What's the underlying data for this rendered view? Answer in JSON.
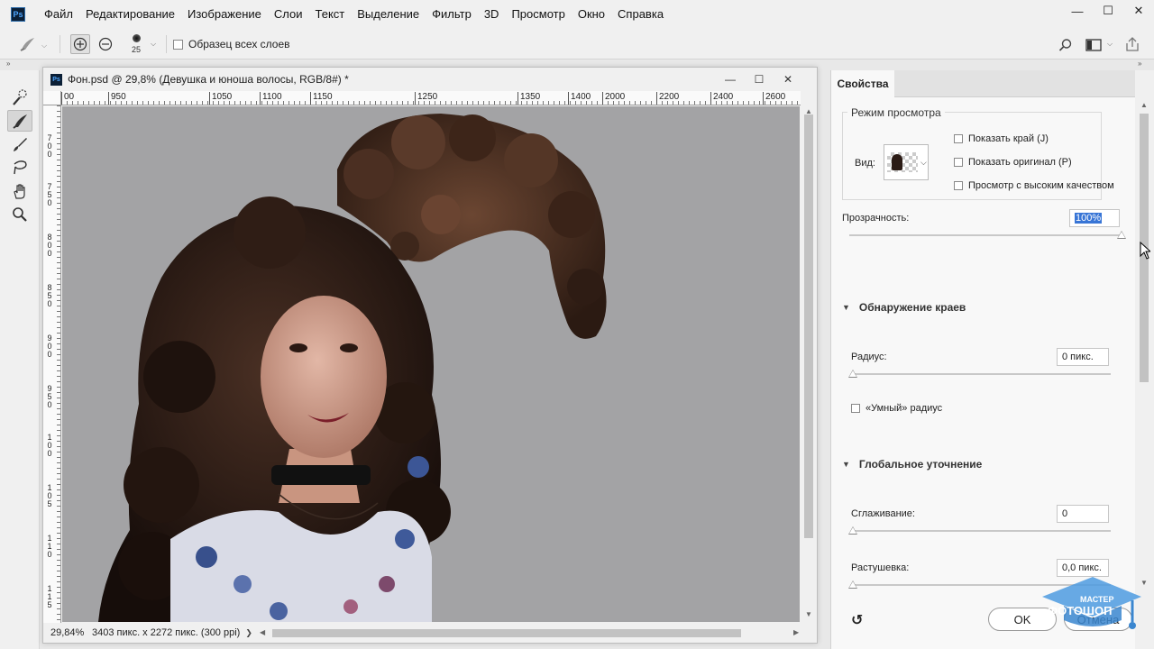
{
  "menu": {
    "logo": "Ps",
    "items": [
      "Файл",
      "Редактирование",
      "Изображение",
      "Слои",
      "Текст",
      "Выделение",
      "Фильтр",
      "3D",
      "Просмотр",
      "Окно",
      "Справка"
    ],
    "window_controls": [
      "—",
      "☐",
      "✕"
    ]
  },
  "options": {
    "brush_size": "25",
    "sample_all_layers_label": "Образец всех слоев",
    "sample_all_layers_checked": false
  },
  "toolbar": {
    "tools": [
      "quick-selection-icon",
      "refine-edge-brush-icon",
      "brush-icon",
      "lasso-icon",
      "hand-icon",
      "zoom-icon"
    ],
    "active_index": 1
  },
  "document": {
    "logo": "Ps",
    "title": "Фон.psd @ 29,8% (Девушка и юноша волосы, RGB/8#) *",
    "ruler_top": [
      "00",
      "950",
      "1050",
      "1100",
      "1150",
      "1250",
      "1350",
      "1400",
      "2000",
      "2200",
      "2400",
      "2600"
    ],
    "ruler_left": [
      "7",
      "0",
      "0",
      "7",
      "5",
      "0",
      "8",
      "0",
      "0",
      "8",
      "5",
      "0",
      "9",
      "0",
      "0",
      "9",
      "5",
      "0",
      "1",
      "0",
      "0",
      "1",
      "0",
      "5",
      "1",
      "1",
      "0",
      "1",
      "1",
      "5"
    ],
    "zoom": "29,84%",
    "info": "3403 пикс. x 2272 пикс. (300 ppi)",
    "info_arrow": "❯",
    "canvas_bg": "#a3a3a5"
  },
  "panel": {
    "tab": "Свойства",
    "view_mode": {
      "title": "Режим просмотра",
      "view_label": "Вид:",
      "show_edge": "Показать край (J)",
      "show_original": "Показать оригинал (P)",
      "high_quality": "Просмотр с высоким качеством"
    },
    "opacity_label": "Прозрачность:",
    "opacity_value": "100%",
    "opacity_fraction": 1.0,
    "edge_detection": {
      "title": "Обнаружение краев",
      "radius_label": "Радиус:",
      "radius_value": "0 пикс.",
      "smart_radius": "«Умный» радиус"
    },
    "global_refine": {
      "title": "Глобальное уточнение",
      "smooth_label": "Сглаживание:",
      "smooth_value": "0",
      "feather_label": "Растушевка:",
      "feather_value": "0,0 пикс."
    },
    "ok": "OK",
    "cancel": "Отмена",
    "reset_icon": "↺"
  },
  "watermark": {
    "line1": "ФОТОШОП",
    "line2": "МАСТЕР"
  }
}
